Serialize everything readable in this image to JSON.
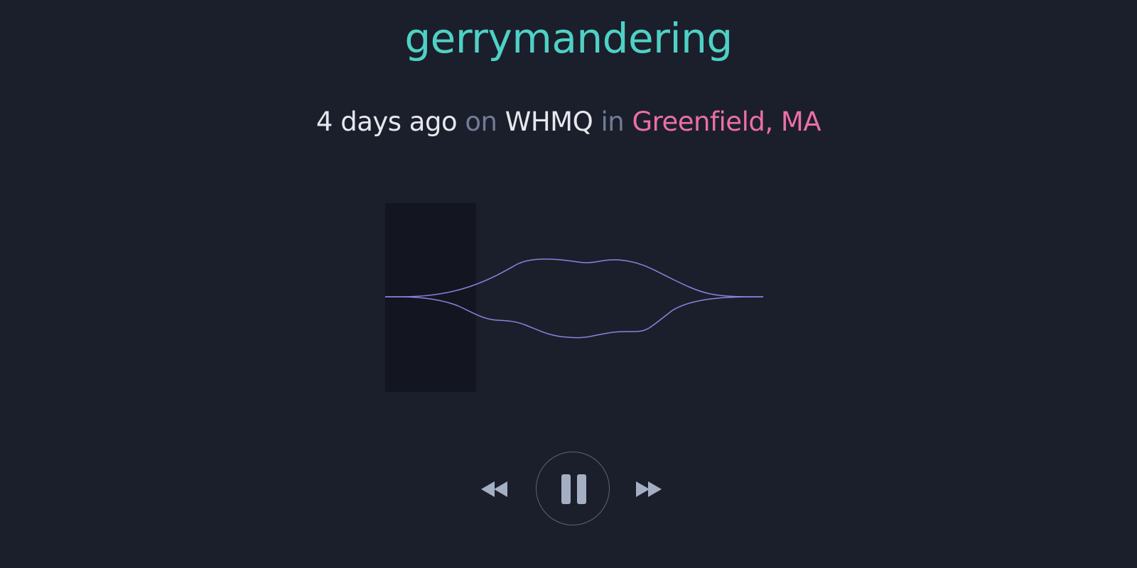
{
  "episode": {
    "title": "gerrymandering"
  },
  "meta": {
    "time_ago": "4 days ago",
    "on_word": "on",
    "station": "WHMQ",
    "in_word": "in",
    "location": "Greenfield, MA"
  },
  "player": {
    "progress_fraction": 0.24,
    "controls": {
      "rewind_icon": "rewind-icon",
      "pause_icon": "pause-icon",
      "forward_icon": "fast-forward-icon"
    }
  },
  "colors": {
    "background": "#1b1f2b",
    "title": "#4fd1c5",
    "location": "#ec6fa6",
    "waveform": "#8f80e0",
    "played_region": "#131620",
    "control": "#a5afc4"
  }
}
